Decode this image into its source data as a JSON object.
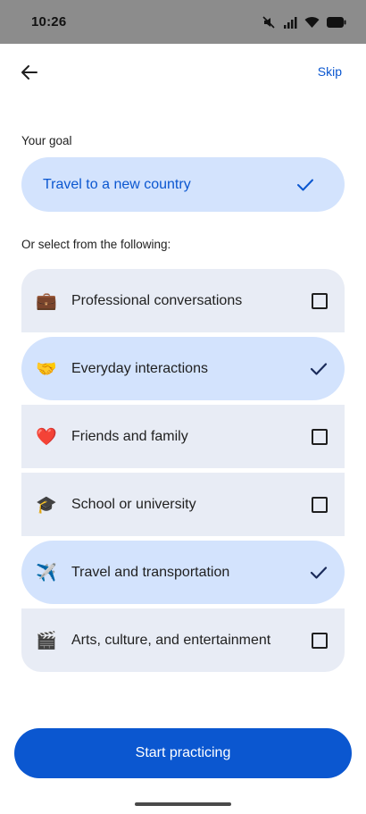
{
  "status_bar": {
    "time": "10:26",
    "icons": [
      "mute-icon",
      "signal-icon",
      "wifi-icon",
      "battery-icon"
    ]
  },
  "header": {
    "back_icon": "arrow-left-icon",
    "skip_label": "Skip"
  },
  "goal": {
    "section_label": "Your goal",
    "value": "Travel to a new country",
    "selected": true
  },
  "options_section": {
    "label": "Or select from the following:",
    "items": [
      {
        "emoji": "💼",
        "label": "Professional conversations",
        "selected": false
      },
      {
        "emoji": "🤝",
        "label": "Everyday interactions",
        "selected": true
      },
      {
        "emoji": "❤️",
        "label": "Friends and family",
        "selected": false
      },
      {
        "emoji": "🎓",
        "label": "School or university",
        "selected": false
      },
      {
        "emoji": "✈️",
        "label": "Travel and transportation",
        "selected": true
      },
      {
        "emoji": "🎬",
        "label": "Arts, culture, and entertainment",
        "selected": false
      }
    ]
  },
  "footer": {
    "start_label": "Start practicing"
  },
  "colors": {
    "accent": "#0b57d0",
    "selected_bg": "#d3e3fd",
    "unselected_bg": "#e8ecf5",
    "status_bar_bg": "#8c8c8c"
  }
}
